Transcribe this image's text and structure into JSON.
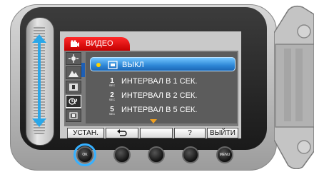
{
  "menu": {
    "tab_label": "ВИДЕО",
    "items": [
      {
        "label": "ВЫКЛ",
        "icon": "off-icon",
        "selected": true
      },
      {
        "label": "ИНТЕРВАЛ В 1 СЕК.",
        "icon": "interval-1sec-icon",
        "selected": false
      },
      {
        "label": "ИНТЕРВАЛ В 2 СЕК.",
        "icon": "interval-2sec-icon",
        "selected": false
      },
      {
        "label": "ИНТЕРВАЛ В 5 СЕК.",
        "icon": "interval-5sec-icon",
        "selected": false
      }
    ],
    "category_icons": [
      "scene-icon",
      "focus-icon",
      "exposure-icon",
      "time-lapse-icon",
      "stabilizer-icon"
    ]
  },
  "softkeys": {
    "set_label": "УСТАН.",
    "back_symbol": "⮌",
    "blank_label": "",
    "help_label": "?",
    "exit_label": "ВЫЙТИ"
  },
  "hardware": {
    "ok_label": "OK",
    "menu_label": "MENU"
  },
  "colors": {
    "tab_red": "#e00000",
    "selection_blue": "#2d86d6",
    "focus_ring": "#36b0ff",
    "slider_arrow": "#2aa7e8",
    "more_arrow": "#f0a020"
  }
}
